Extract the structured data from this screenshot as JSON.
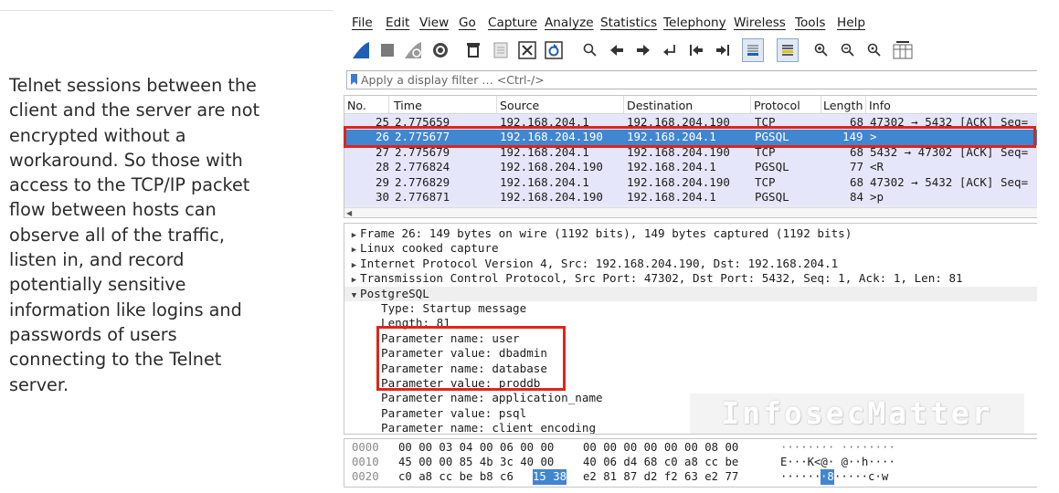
{
  "description": "Telnet sessions between the client and the server are not encrypted without a workaround. So those with access to the TCP/IP packet flow between hosts can observe all of the traffic, listen in, and record potentially sensitive information like logins and passwords of users connecting to the Telnet server.",
  "menu": [
    "File",
    "Edit",
    "View",
    "Go",
    "Capture",
    "Analyze",
    "Statistics",
    "Telephony",
    "Wireless",
    "Tools",
    "Help"
  ],
  "toolbar_icons": [
    "shark-fin-icon",
    "stop-icon",
    "restart-icon",
    "options-gear-icon",
    "open-file-icon",
    "save-file-icon",
    "close-file-icon",
    "reload-icon",
    "search-icon",
    "back-arrow-icon",
    "forward-arrow-icon",
    "go-to-packet-icon",
    "first-packet-icon",
    "last-packet-icon",
    "autoscroll-icon",
    "colorize-icon",
    "zoom-in-icon",
    "zoom-out-icon",
    "zoom-normal-icon",
    "resize-columns-icon"
  ],
  "filter": {
    "placeholder": "Apply a display filter … <Ctrl-/>"
  },
  "packet_list": {
    "columns": [
      "No.",
      "Time",
      "Source",
      "Destination",
      "Protocol",
      "Length",
      "Info"
    ],
    "rows": [
      {
        "no": "25",
        "time": "2.775659",
        "src": "192.168.204.1",
        "dst": "192.168.204.190",
        "proto": "TCP",
        "len": "68",
        "info": "47302 → 5432 [ACK] Seq="
      },
      {
        "no": "26",
        "time": "2.775677",
        "src": "192.168.204.190",
        "dst": "192.168.204.1",
        "proto": "PGSQL",
        "len": "149",
        "info": ">"
      },
      {
        "no": "27",
        "time": "2.775679",
        "src": "192.168.204.1",
        "dst": "192.168.204.190",
        "proto": "TCP",
        "len": "68",
        "info": "5432 → 47302 [ACK] Seq="
      },
      {
        "no": "28",
        "time": "2.776824",
        "src": "192.168.204.190",
        "dst": "192.168.204.1",
        "proto": "PGSQL",
        "len": "77",
        "info": "<R"
      },
      {
        "no": "29",
        "time": "2.776829",
        "src": "192.168.204.1",
        "dst": "192.168.204.190",
        "proto": "TCP",
        "len": "68",
        "info": "47302 → 5432 [ACK] Seq="
      },
      {
        "no": "30",
        "time": "2.776871",
        "src": "192.168.204.190",
        "dst": "192.168.204.1",
        "proto": "PGSQL",
        "len": "84",
        "info": ">p"
      }
    ]
  },
  "details": {
    "frame": "Frame 26: 149 bytes on wire (1192 bits), 149 bytes captured (1192 bits)",
    "linux": "Linux cooked capture",
    "ip": "Internet Protocol Version 4, Src: 192.168.204.190, Dst: 192.168.204.1",
    "tcp": "Transmission Control Protocol, Src Port: 47302, Dst Port: 5432, Seq: 1, Ack: 1, Len: 81",
    "pgsql": "PostgreSQL",
    "type": "Type: Startup message",
    "length": "Length: 81",
    "p1": "Parameter name: user",
    "p2": "Parameter value: dbadmin",
    "p3": "Parameter name: database",
    "p4": "Parameter value: proddb",
    "p5": "Parameter name: application_name",
    "p6": "Parameter value: psql",
    "p7": "Parameter name: client_encoding"
  },
  "bytes": {
    "rows": [
      {
        "offset": "0000",
        "hex_a": "00 00 03 04 00 06 00 00",
        "hex_b": "00 00 00 00 00 00 08 00",
        "ascii": "········ ········"
      },
      {
        "offset": "0010",
        "hex_a": "45 00 00 85 4b 3c 40 00",
        "hex_b": "40 06 d4 68 c0 a8 cc be",
        "ascii": "E···K<@· @··h····"
      },
      {
        "offset": "0020",
        "hex_a_pre": "c0 a8 cc be b8 c6",
        "hex_a_sel": "15 38",
        "hex_b": "e2 81 87 d2 f2 63 e2 77",
        "ascii_pre": "······",
        "ascii_sel": "·8",
        "ascii_post": " ·····c·w"
      }
    ]
  },
  "watermark": "InfosecMatter",
  "colors": {
    "selected_row": "#4086d1",
    "packet_row": "#e6e6fa",
    "highlight_box": "#e0241b"
  }
}
